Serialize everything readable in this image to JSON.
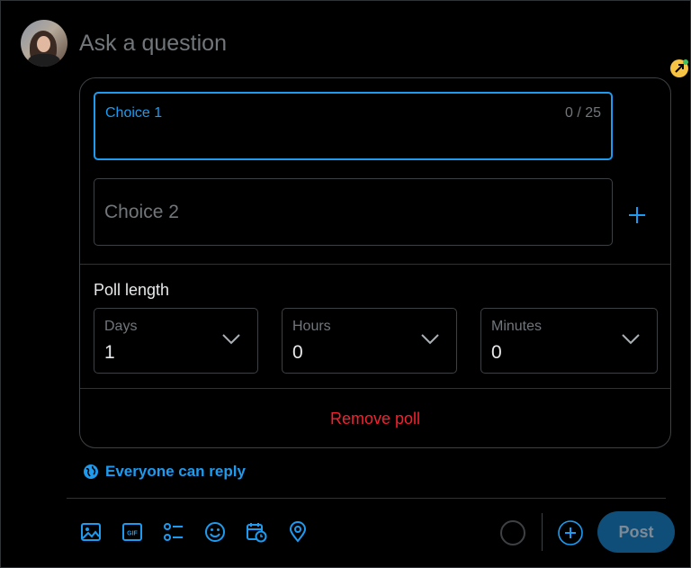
{
  "composer": {
    "placeholder": "Ask a question"
  },
  "poll": {
    "choices": [
      {
        "label": "Choice 1",
        "counter": "0 / 25"
      },
      {
        "placeholder": "Choice 2"
      }
    ],
    "length_title": "Poll length",
    "days": {
      "label": "Days",
      "value": "1"
    },
    "hours": {
      "label": "Hours",
      "value": "0"
    },
    "minutes": {
      "label": "Minutes",
      "value": "0"
    },
    "remove_label": "Remove poll"
  },
  "reply_setting": {
    "label": "Everyone can reply",
    "icon": "globe-icon"
  },
  "toolbar": {
    "icons": [
      "image-icon",
      "gif-icon",
      "poll-icon",
      "emoji-icon",
      "schedule-icon",
      "location-icon"
    ],
    "post_label": "Post"
  },
  "colors": {
    "accent": "#1d9bf0",
    "danger": "#f4212e",
    "background": "#000000",
    "border": "#3e4144",
    "muted_text": "#71767b",
    "post_button_disabled": "#0f4e78"
  }
}
